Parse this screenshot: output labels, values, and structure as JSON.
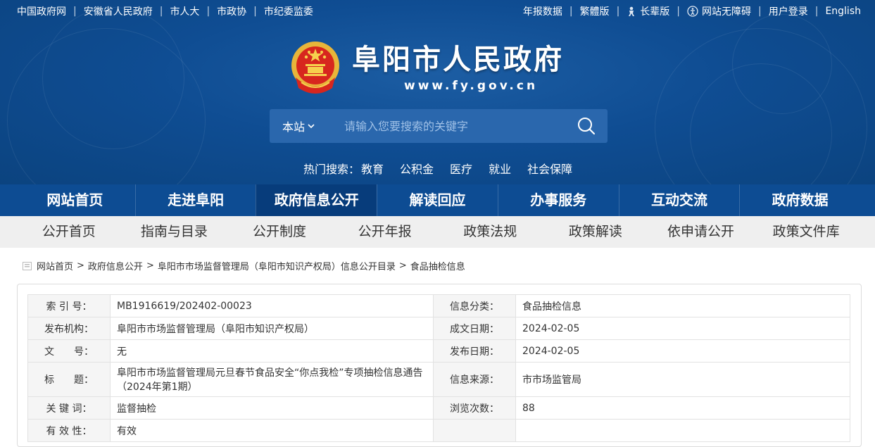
{
  "topbar": {
    "left_links": [
      "中国政府网",
      "安徽省人民政府",
      "市人大",
      "市政协",
      "市纪委监委"
    ],
    "right_links": [
      {
        "label": "年报数据",
        "icon": ""
      },
      {
        "label": "繁體版",
        "icon": ""
      },
      {
        "label": "长辈版",
        "icon": "elder-icon"
      },
      {
        "label": "网站无障碍",
        "icon": "accessibility-icon"
      },
      {
        "label": "用户登录",
        "icon": ""
      },
      {
        "label": "English",
        "icon": ""
      }
    ]
  },
  "brand": {
    "title": "阜阳市人民政府",
    "url": "www.fy.gov.cn"
  },
  "search": {
    "scope": "本站",
    "placeholder": "请输入您要搜索的关键字"
  },
  "hot_search": {
    "label": "热门搜索：",
    "items": [
      "教育",
      "公积金",
      "医疗",
      "就业",
      "社会保障"
    ]
  },
  "main_nav": {
    "items": [
      "网站首页",
      "走进阜阳",
      "政府信息公开",
      "解读回应",
      "办事服务",
      "互动交流",
      "政府数据"
    ],
    "active_index": 2
  },
  "sub_nav": {
    "items": [
      "公开首页",
      "指南与目录",
      "公开制度",
      "公开年报",
      "政策法规",
      "政策解读",
      "依申请公开",
      "政策文件库"
    ]
  },
  "breadcrumb": [
    "网站首页",
    "政府信息公开",
    "阜阳市市场监督管理局（阜阳市知识产权局）信息公开目录",
    "食品抽检信息"
  ],
  "meta": {
    "rows": [
      {
        "l1": "索 引 号：",
        "v1": "MB1916619/202402-00023",
        "l2": "信息分类：",
        "v2": "食品抽检信息"
      },
      {
        "l1": "发布机构：",
        "v1": "阜阳市市场监督管理局（阜阳市知识产权局）",
        "l2": "成文日期：",
        "v2": "2024-02-05"
      },
      {
        "l1": "文　　号：",
        "v1": "无",
        "l2": "发布日期：",
        "v2": "2024-02-05"
      },
      {
        "l1": "标　　题：",
        "v1": "阜阳市市场监督管理局元旦春节食品安全“你点我检”专项抽检信息通告（2024年第1期）",
        "l2": "信息来源：",
        "v2": "市市场监管局"
      },
      {
        "l1": "关 键 词：",
        "v1": "监督抽检",
        "l2": "浏览次数：",
        "v2": "88"
      },
      {
        "l1": "有 效 性：",
        "v1": "有效",
        "l2": "",
        "v2": ""
      }
    ]
  },
  "colors": {
    "header_blue": "#0f4d93",
    "nav_blue": "#0d4c93",
    "nav_active": "#073c7b",
    "subnav_bg": "#efefef"
  }
}
